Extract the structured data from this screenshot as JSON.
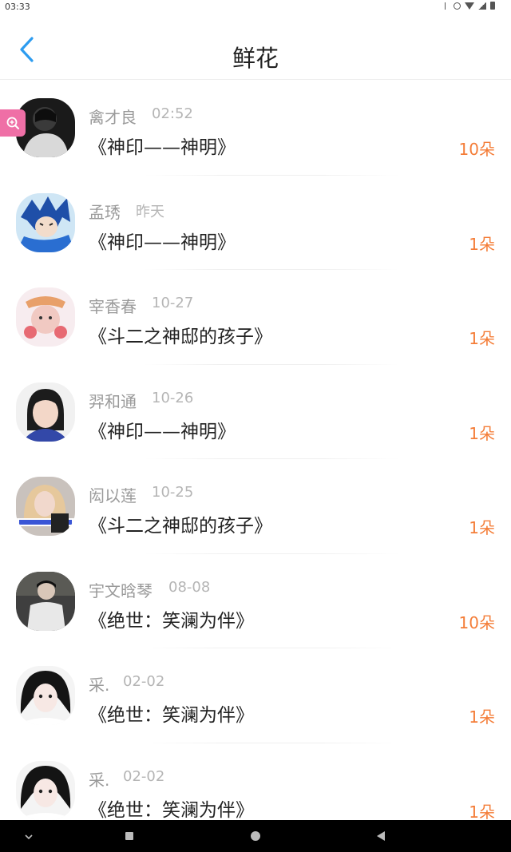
{
  "status_bar": {
    "time": "03:33"
  },
  "header": {
    "title": "鲜花"
  },
  "list": [
    {
      "name": "禽才良",
      "time": "02:52",
      "book": "《神印——神明》",
      "count": "10朵"
    },
    {
      "name": "孟琇",
      "time": "昨天",
      "book": "《神印——神明》",
      "count": "1朵"
    },
    {
      "name": "宰香春",
      "time": "10-27",
      "book": "《斗二之神邸的孩子》",
      "count": "1朵"
    },
    {
      "name": "羿和通",
      "time": "10-26",
      "book": "《神印——神明》",
      "count": "1朵"
    },
    {
      "name": "闳以莲",
      "time": "10-25",
      "book": "《斗二之神邸的孩子》",
      "count": "1朵"
    },
    {
      "name": "宇文晗琴",
      "time": "08-08",
      "book": "《绝世：笑澜为伴》",
      "count": "10朵"
    },
    {
      "name": "采.",
      "time": "02-02",
      "book": "《绝世：笑澜为伴》",
      "count": "1朵"
    },
    {
      "name": "采.",
      "time": "02-02",
      "book": "《绝世：笑澜为伴》",
      "count": "1朵"
    }
  ],
  "colors": {
    "accent_blue": "#2d9cf0",
    "count_orange": "#f47d38",
    "name_gray": "#9a9a9a"
  }
}
